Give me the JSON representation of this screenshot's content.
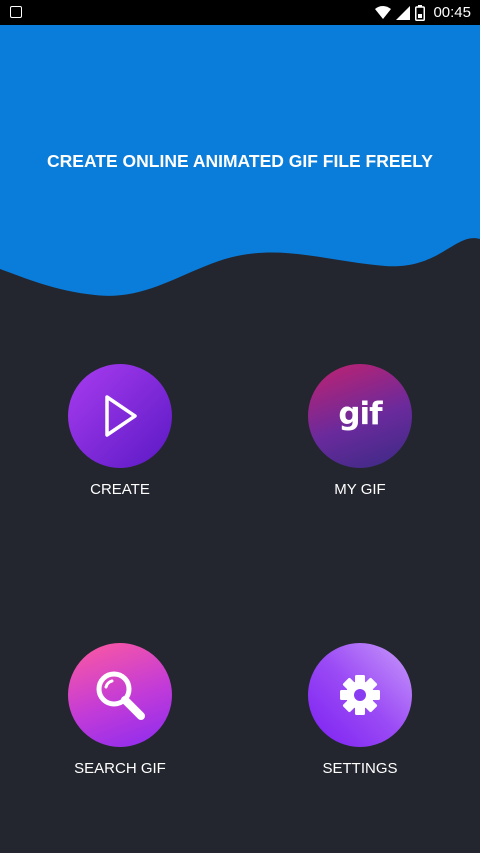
{
  "status_bar": {
    "time": "00:45",
    "icons": [
      "app-notification-icon",
      "wifi-icon",
      "cell-signal-icon",
      "battery-icon"
    ]
  },
  "header": {
    "title": "CREATE ONLINE ANIMATED GIF FILE FREELY",
    "background_color": "#0a7cda"
  },
  "menu": {
    "create": {
      "label": "CREATE",
      "icon": "play-icon"
    },
    "my_gif": {
      "label": "MY GIF",
      "icon": "gif-icon",
      "icon_text": "gif"
    },
    "search_gif": {
      "label": "SEARCH GIF",
      "icon": "search-icon"
    },
    "settings": {
      "label": "SETTINGS",
      "icon": "gear-icon"
    }
  },
  "colors": {
    "background": "#23262f",
    "header_blue": "#0a7cda",
    "accent_purple": "#7b2ff7",
    "accent_pink": "#ff4f9a"
  }
}
